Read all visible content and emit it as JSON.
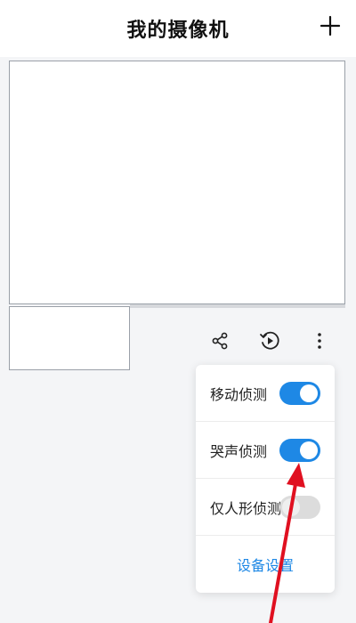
{
  "header": {
    "title": "我的摄像机",
    "add_icon": "plus-icon"
  },
  "actions": {
    "icons": [
      "share-icon",
      "playback-icon",
      "more-vertical-icon"
    ]
  },
  "menu": {
    "items": [
      {
        "label": "移动侦测",
        "enabled": true
      },
      {
        "label": "哭声侦测",
        "enabled": true
      },
      {
        "label": "仅人形侦测",
        "enabled": false
      }
    ],
    "settings_label": "设备设置"
  },
  "colors": {
    "accent": "#1e88e5",
    "toggle_off": "#dcdcdc",
    "arrow": "#e01020"
  }
}
